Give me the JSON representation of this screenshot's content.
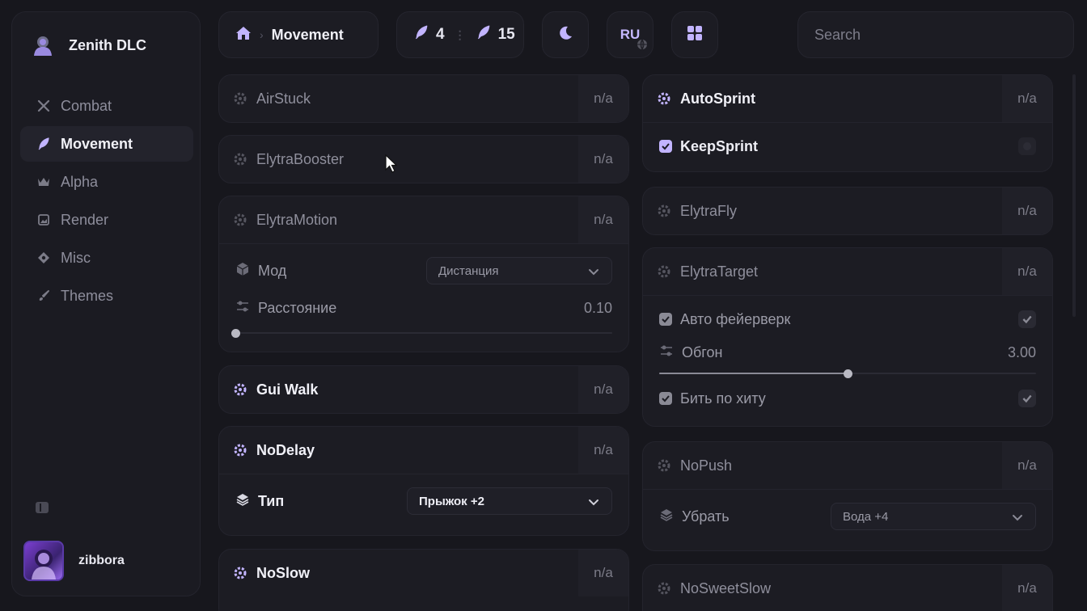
{
  "app": {
    "name": "Zenith DLC"
  },
  "sidebar": {
    "items": [
      {
        "label": "Combat",
        "icon": "swords-icon",
        "active": false
      },
      {
        "label": "Movement",
        "icon": "feather-icon",
        "active": true
      },
      {
        "label": "Alpha",
        "icon": "crown-icon",
        "active": false
      },
      {
        "label": "Render",
        "icon": "image-icon",
        "active": false
      },
      {
        "label": "Misc",
        "icon": "puzzle-icon",
        "active": false
      },
      {
        "label": "Themes",
        "icon": "brush-icon",
        "active": false
      }
    ]
  },
  "user": {
    "name": "zibbora"
  },
  "header": {
    "breadcrumb_title": "Movement",
    "enabled_count": "4",
    "total_count": "15",
    "language": "RU",
    "search_placeholder": "Search"
  },
  "modules_left": {
    "airstuck": {
      "name": "AirStuck",
      "bind": "n/a"
    },
    "elytrabooster": {
      "name": "ElytraBooster",
      "bind": "n/a"
    },
    "elytramotion": {
      "name": "ElytraMotion",
      "bind": "n/a",
      "mode_label": "Мод",
      "mode_value": "Дистанция",
      "distance_label": "Расстояние",
      "distance_value": "0.10",
      "distance_fraction": 0.0
    },
    "guiwalk": {
      "name": "Gui Walk",
      "bind": "n/a"
    },
    "nodelay": {
      "name": "NoDelay",
      "bind": "n/a",
      "type_label": "Тип",
      "type_value": "Прыжок +2"
    },
    "noslow": {
      "name": "NoSlow",
      "bind": "n/a"
    }
  },
  "modules_right": {
    "autosprint": {
      "name": "AutoSprint",
      "bind": "n/a",
      "keepsprint_label": "KeepSprint",
      "keepsprint_checked": true
    },
    "elytrafly": {
      "name": "ElytraFly",
      "bind": "n/a"
    },
    "elytratarget": {
      "name": "ElytraTarget",
      "bind": "n/a",
      "auto_firework_label": "Авто фейерверк",
      "auto_firework_checked": true,
      "overtake_label": "Обгон",
      "overtake_value": "3.00",
      "overtake_fraction": 0.5,
      "hit_label": "Бить по хиту",
      "hit_checked": true
    },
    "nopush": {
      "name": "NoPush",
      "bind": "n/a",
      "remove_label": "Убрать",
      "remove_value": "Вода +4"
    },
    "nosweetslow": {
      "name": "NoSweetSlow",
      "bind": "n/a"
    }
  },
  "colors": {
    "accent": "#c2b4ff",
    "background": "#17171d",
    "panel": "#1c1c23"
  }
}
